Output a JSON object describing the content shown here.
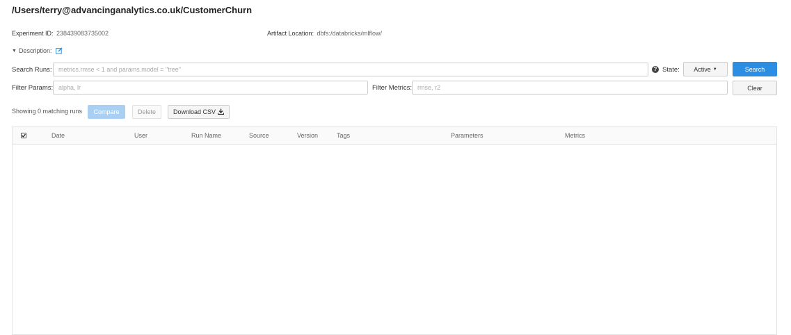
{
  "header": {
    "title": "/Users/terry@advancinganalytics.co.uk/CustomerChurn"
  },
  "meta": {
    "experiment_id_label": "Experiment ID:",
    "experiment_id_value": "238439083735002",
    "artifact_location_label": "Artifact Location:",
    "artifact_location_value": "dbfs:/databricks/mlflow/"
  },
  "description": {
    "label": "Description:"
  },
  "search": {
    "label": "Search Runs:",
    "placeholder": "metrics.rmse < 1 and params.model = \"tree\"",
    "value": "",
    "state_label": "State:",
    "state_value": "Active",
    "search_button": "Search"
  },
  "filters": {
    "params_label": "Filter Params:",
    "params_placeholder": "alpha, lr",
    "metrics_label": "Filter Metrics:",
    "metrics_placeholder": "rmse, r2",
    "clear_button": "Clear"
  },
  "runs_toolbar": {
    "showing_text": "Showing 0 matching runs",
    "compare_button": "Compare",
    "delete_button": "Delete",
    "download_button": "Download CSV"
  },
  "table": {
    "columns": [
      "Date",
      "User",
      "Run Name",
      "Source",
      "Version",
      "Tags",
      "Parameters",
      "Metrics"
    ],
    "rows": []
  },
  "icons": {
    "help": "question-circle-icon",
    "edit": "edit-icon",
    "download": "download-icon",
    "checkbox": "checkbox-icon"
  },
  "colors": {
    "primary": "#2b8ee3",
    "primary_disabled": "#a9d0f2",
    "link": "#2b8ee3"
  }
}
